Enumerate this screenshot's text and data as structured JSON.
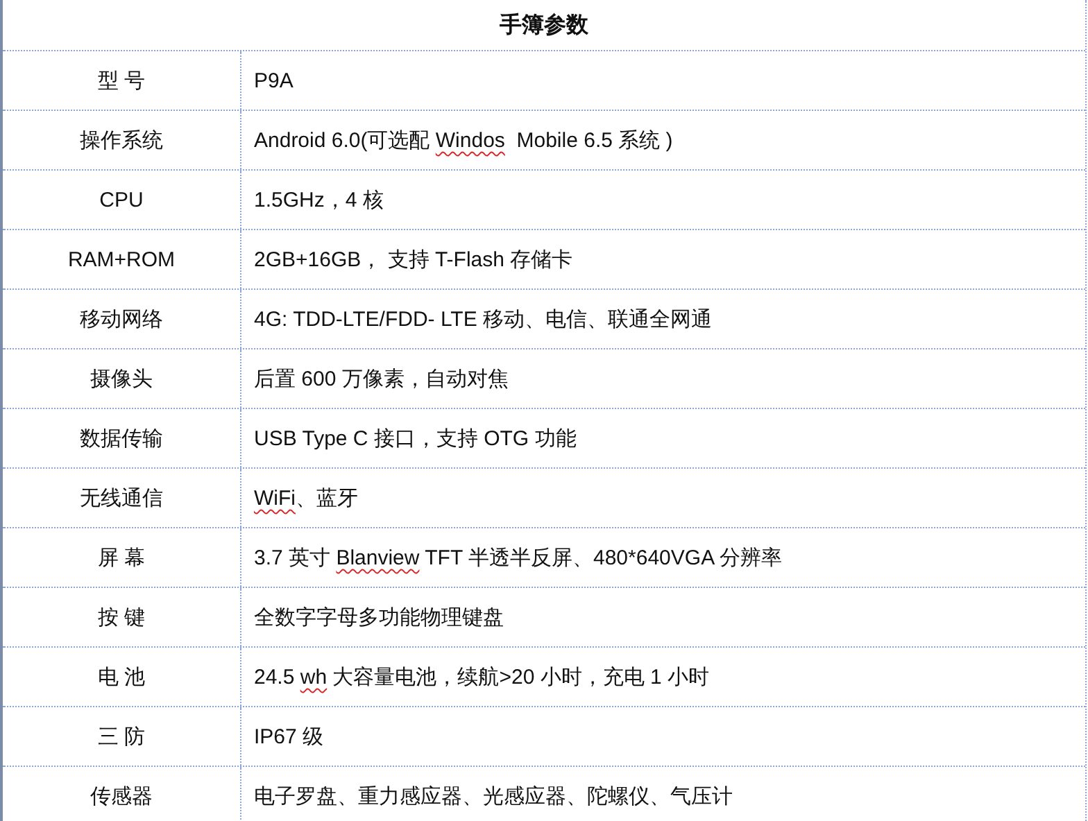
{
  "table": {
    "title": "手簿参数",
    "rows": [
      {
        "label": "型 号",
        "value": [
          {
            "text": "P9A",
            "misspelled": false
          }
        ]
      },
      {
        "label": "操作系统",
        "value": [
          {
            "text": "Android 6.0(可选配 ",
            "misspelled": false
          },
          {
            "text": "Windos",
            "misspelled": true
          },
          {
            "text": "  Mobile 6.5 系统 )",
            "misspelled": false
          }
        ]
      },
      {
        "label": "CPU",
        "value": [
          {
            "text": "1.5GHz，4 核",
            "misspelled": false
          }
        ]
      },
      {
        "label": "RAM+ROM",
        "value": [
          {
            "text": "2GB+16GB， 支持 T-Flash 存储卡",
            "misspelled": false
          }
        ]
      },
      {
        "label": "移动网络",
        "value": [
          {
            "text": "4G: TDD-LTE/FDD- LTE 移动、电信、联通全网通",
            "misspelled": false
          }
        ]
      },
      {
        "label": "摄像头",
        "value": [
          {
            "text": "后置 600 万像素，自动对焦",
            "misspelled": false
          }
        ]
      },
      {
        "label": "数据传输",
        "value": [
          {
            "text": "USB Type C 接口，支持 OTG 功能",
            "misspelled": false
          }
        ]
      },
      {
        "label": "无线通信",
        "value": [
          {
            "text": "WiFi",
            "misspelled": true
          },
          {
            "text": "、蓝牙",
            "misspelled": false
          }
        ]
      },
      {
        "label": "屏 幕",
        "value": [
          {
            "text": "3.7 英寸 ",
            "misspelled": false
          },
          {
            "text": "Blanview",
            "misspelled": true
          },
          {
            "text": " TFT 半透半反屏、480*640VGA 分辨率",
            "misspelled": false
          }
        ]
      },
      {
        "label": "按 键",
        "value": [
          {
            "text": "全数字字母多功能物理键盘",
            "misspelled": false
          }
        ]
      },
      {
        "label": "电 池",
        "value": [
          {
            "text": "24.5 ",
            "misspelled": false
          },
          {
            "text": "wh",
            "misspelled": true
          },
          {
            "text": " 大容量电池，续航>20 小时，充电 1 小时",
            "misspelled": false
          }
        ]
      },
      {
        "label": "三 防",
        "value": [
          {
            "text": "IP67 级",
            "misspelled": false
          }
        ]
      },
      {
        "label": "传感器",
        "value": [
          {
            "text": "电子罗盘、重力感应器、光感应器、陀螺仪、气压计",
            "misspelled": false
          }
        ]
      }
    ]
  }
}
